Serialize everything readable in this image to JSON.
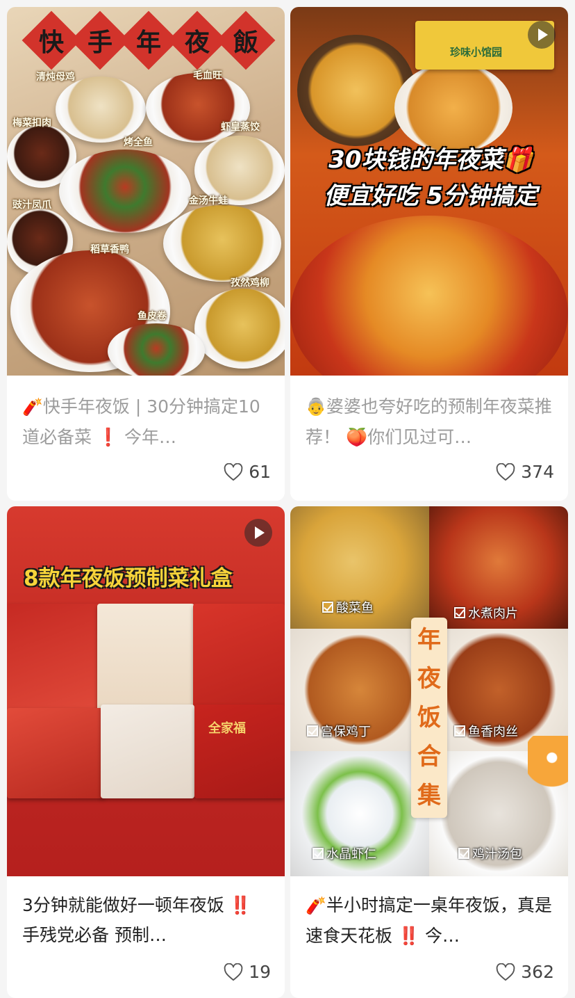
{
  "cards": [
    {
      "cover_banner": [
        "快",
        "手",
        "年",
        "夜",
        "飯"
      ],
      "cover_labels": [
        "清炖母鸡",
        "毛血旺",
        "梅菜扣肉",
        "虾皇蒸饺",
        "烤全鱼",
        "金汤牛蛙",
        "豉汁凤爪",
        "稻草香鸭",
        "孜然鸡柳",
        "鱼皮卷"
      ],
      "title_emoji": "🧨",
      "title": "快手年夜饭 | 30分钟搞定10道必备菜 ❗ 今年…",
      "likes": "61"
    },
    {
      "cover_headline_1": "30块钱的年夜菜🎁",
      "cover_headline_2": "便宜好吃 5分钟搞定",
      "cover_box_text": "珍味小馆园",
      "title_emoji": "👵",
      "title": "婆婆也夸好吃的预制年夜菜推荐！ 🍑你们见过可…",
      "likes": "374"
    },
    {
      "cover_headline": "8款年夜饭预制菜礼盒",
      "cover_box_label": "全家福",
      "title": "3分钟就能做好一顿年夜饭 ‼️ 手残党必备 预制…",
      "likes": "19"
    },
    {
      "cover_tags": [
        "酸菜鱼",
        "水煮肉片",
        "宫保鸡丁",
        "鱼香肉丝",
        "水晶虾仁",
        "鸡汁汤包"
      ],
      "cover_vertical": [
        "年",
        "夜",
        "饭",
        "合",
        "集"
      ],
      "title_emoji": "🧨",
      "title": "半小时搞定一桌年夜饭，真是速食天花板 ‼️ 今…",
      "likes": "362"
    }
  ],
  "colors": {
    "title_muted": "#9c9c9c",
    "title_dark": "#222222",
    "accent_red": "#d2332b"
  },
  "icons": {
    "like": "heart-outline-icon",
    "video": "play-icon"
  }
}
